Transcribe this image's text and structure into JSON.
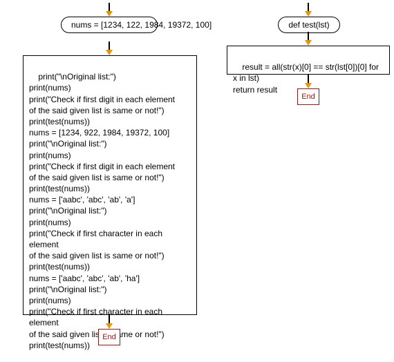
{
  "left": {
    "start_label": "nums = [1234, 122,\n1984, 19372, 100]",
    "process_text": "print(\"\\nOriginal list:\")\nprint(nums)\nprint(\"Check if first digit in each element\nof the said given list is same or not!\")\nprint(test(nums))\nnums = [1234, 922, 1984, 19372, 100]\nprint(\"\\nOriginal list:\")\nprint(nums)\nprint(\"Check if first digit in each element\nof the said given list is same or not!\")\nprint(test(nums))\nnums = ['aabc', 'abc', 'ab', 'a']\nprint(\"\\nOriginal list:\")\nprint(nums)\nprint(\"Check if first character in each element\nof the said given list is same or not!\")\nprint(test(nums))\nnums = ['aabc', 'abc', 'ab', 'ha']\nprint(\"\\nOriginal list:\")\nprint(nums)\nprint(\"Check if first character in each element\nof the said given list is same or not!\")\nprint(test(nums))",
    "end_label": "End"
  },
  "right": {
    "start_label": "def test(lst)",
    "process_text": "result = all(str(x)[0] == str(lst[0])[0] for x in lst)\nreturn result",
    "end_label": "End"
  }
}
